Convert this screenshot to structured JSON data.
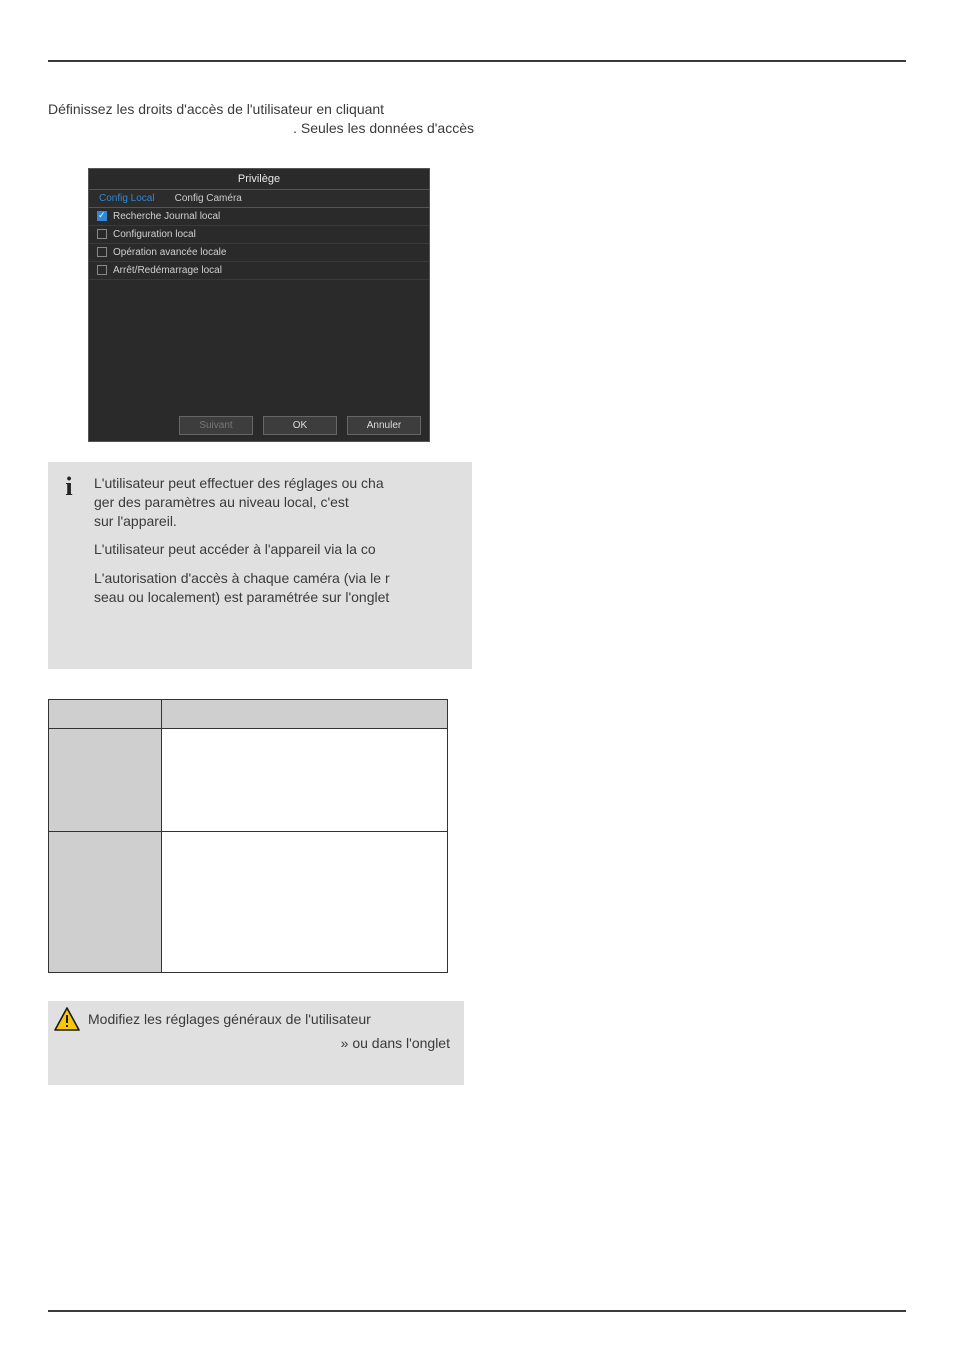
{
  "intro": {
    "line1": "Définissez les droits d'accès de l'utilisateur en cliquant",
    "line2": ". Seules les données d'accès"
  },
  "panel": {
    "title": "Privilège",
    "tabs": {
      "local": "Config Local",
      "camera": "Config Caméra"
    },
    "items": [
      {
        "label": "Recherche Journal local",
        "checked": true
      },
      {
        "label": "Configuration local",
        "checked": false
      },
      {
        "label": "Opération avancée locale",
        "checked": false
      },
      {
        "label": "Arrêt/Redémarrage local",
        "checked": false
      }
    ],
    "buttons": {
      "next": "Suivant",
      "ok": "OK",
      "cancel": "Annuler"
    }
  },
  "note": {
    "p1a": "L'utilisateur peut effectuer des réglages ou cha",
    "p1b": "ger des paramètres au niveau local, c'est",
    "p1c": "sur l'appareil.",
    "p2": "L'utilisateur peut accéder à l'appareil via la co",
    "p3a": "L'autorisation d'accès à chaque caméra (via le r",
    "p3b": "seau ou localement) est paramétrée sur l'onglet"
  },
  "warning": {
    "line1": "Modifiez les réglages généraux de l'utilisateur",
    "line2": "» ou dans l'onglet"
  }
}
